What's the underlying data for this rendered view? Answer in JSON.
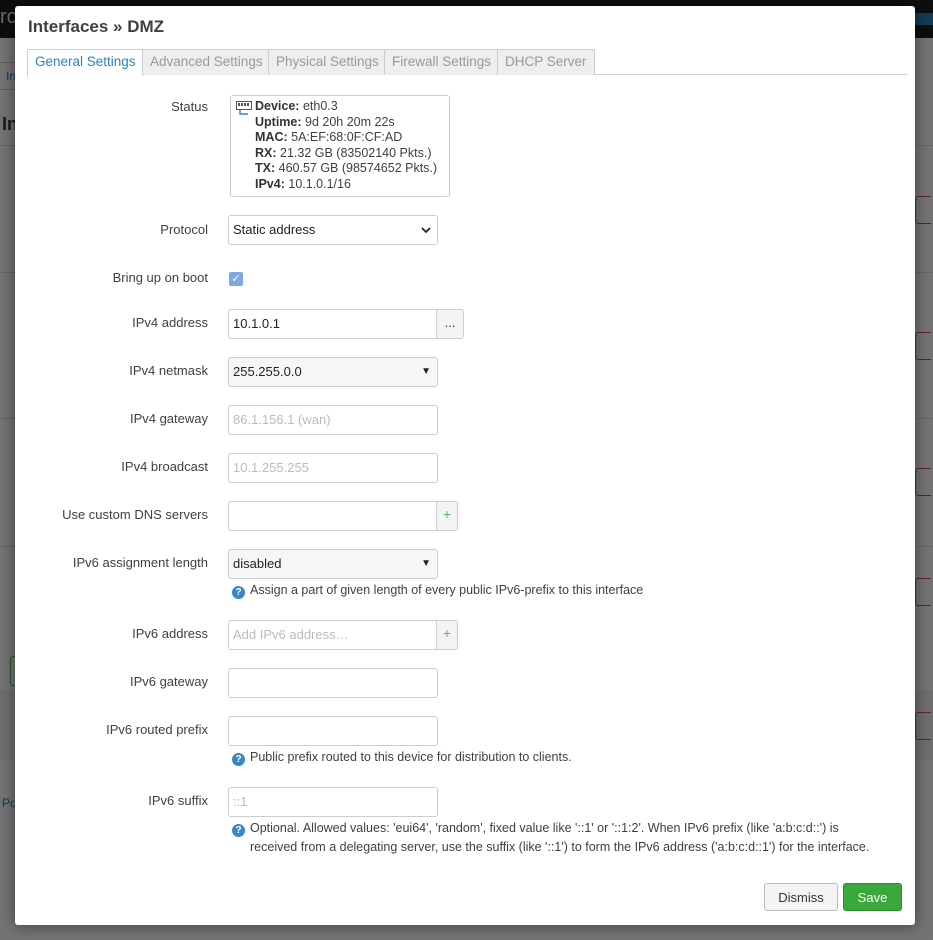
{
  "background": {
    "brand_fragment": "ro",
    "tab_fragment": "In",
    "heading_fragment": "In",
    "link_fragment": "Po"
  },
  "modal": {
    "title": "Interfaces » DMZ",
    "tabs": [
      {
        "label": "General Settings",
        "active": true
      },
      {
        "label": "Advanced Settings"
      },
      {
        "label": "Physical Settings"
      },
      {
        "label": "Firewall Settings"
      },
      {
        "label": "DHCP Server"
      }
    ]
  },
  "status": {
    "label": "Status",
    "icon": "network-port-icon",
    "device_key": "Device:",
    "device": "eth0.3",
    "uptime_key": "Uptime:",
    "uptime": "9d 20h 20m 22s",
    "mac_key": "MAC:",
    "mac": "5A:EF:68:0F:CF:AD",
    "rx_key": "RX:",
    "rx": "21.32 GB (83502140 Pkts.)",
    "tx_key": "TX:",
    "tx": "460.57 GB (98574652 Pkts.)",
    "ipv4_key": "IPv4:",
    "ipv4": "10.1.0.1/16"
  },
  "fields": {
    "protocol": {
      "label": "Protocol",
      "value": "Static address"
    },
    "boot": {
      "label": "Bring up on boot",
      "checked": true
    },
    "ipv4_address": {
      "label": "IPv4 address",
      "value": "10.1.0.1",
      "addon": "..."
    },
    "ipv4_netmask": {
      "label": "IPv4 netmask",
      "value": "255.255.0.0"
    },
    "ipv4_gateway": {
      "label": "IPv4 gateway",
      "placeholder": "86.1.156.1 (wan)"
    },
    "ipv4_broadcast": {
      "label": "IPv4 broadcast",
      "placeholder": "10.1.255.255"
    },
    "dns": {
      "label": "Use custom DNS servers",
      "addon": "+"
    },
    "ipv6_assign": {
      "label": "IPv6 assignment length",
      "value": "disabled",
      "help": "Assign a part of given length of every public IPv6-prefix to this interface"
    },
    "ipv6_address": {
      "label": "IPv6 address",
      "placeholder": "Add IPv6 address…",
      "addon": "+"
    },
    "ipv6_gateway": {
      "label": "IPv6 gateway"
    },
    "ipv6_prefix": {
      "label": "IPv6 routed prefix",
      "help": "Public prefix routed to this device for distribution to clients."
    },
    "ipv6_suffix": {
      "label": "IPv6 suffix",
      "placeholder": "::1",
      "help_line1": "Optional. Allowed values: 'eui64', 'random', fixed value like '::1' or '::1:2'. When IPv6 prefix (like 'a:b:c:d::') is",
      "help_line2": "received from a delegating server, use the suffix (like '::1') to form the IPv6 address ('a:b:c:d::1') for the interface."
    }
  },
  "buttons": {
    "dismiss": "Dismiss",
    "save": "Save"
  },
  "colors": {
    "accent": "#2c83b8",
    "save": "#3aa83a",
    "help": "#3b86c8"
  }
}
